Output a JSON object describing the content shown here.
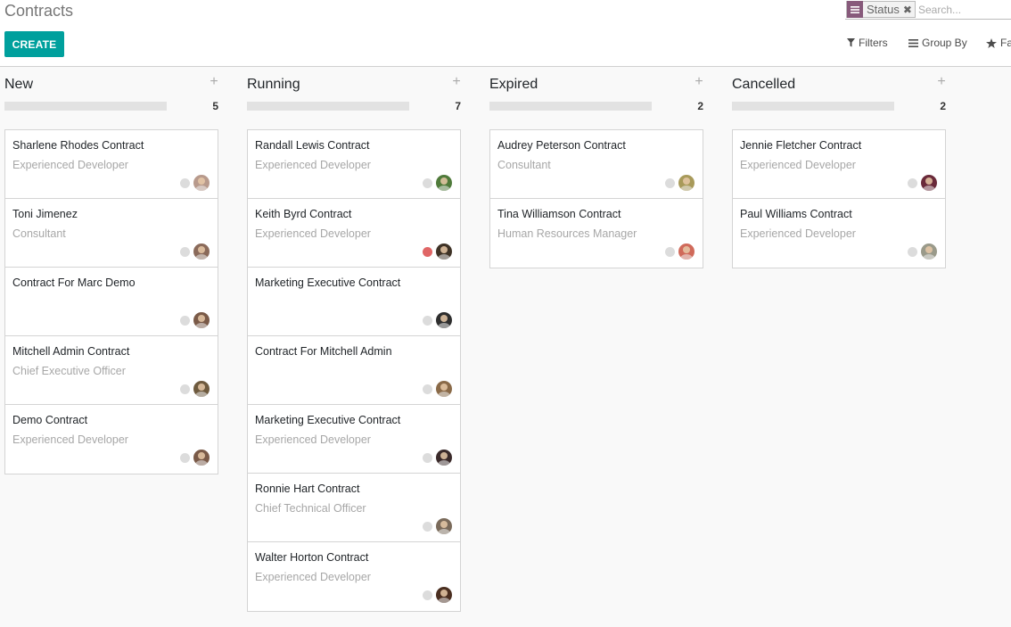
{
  "breadcrumb": "Contracts",
  "create_label": "CREATE",
  "search": {
    "facet_value": "Status",
    "placeholder": "Search...",
    "filters_label": "Filters",
    "groupby_label": "Group By",
    "favorites_label": "Fa"
  },
  "columns": [
    {
      "title": "New",
      "count": "5",
      "cards": [
        {
          "title": "Sharlene Rhodes Contract",
          "subtitle": "Experienced Developer",
          "state": "normal",
          "avatar_color": "#b89a8c"
        },
        {
          "title": "Toni Jimenez",
          "subtitle": "Consultant",
          "state": "normal",
          "avatar_color": "#8a6a5a"
        },
        {
          "title": "Contract For Marc Demo",
          "subtitle": "",
          "state": "normal",
          "avatar_color": "#7a5a48"
        },
        {
          "title": "Mitchell Admin Contract",
          "subtitle": "Chief Executive Officer",
          "state": "normal",
          "avatar_color": "#6e5a3e"
        },
        {
          "title": "Demo Contract",
          "subtitle": "Experienced Developer",
          "state": "normal",
          "avatar_color": "#7a5a48"
        }
      ]
    },
    {
      "title": "Running",
      "count": "7",
      "cards": [
        {
          "title": "Randall Lewis Contract",
          "subtitle": "Experienced Developer",
          "state": "normal",
          "avatar_color": "#4f7a3a"
        },
        {
          "title": "Keith Byrd Contract",
          "subtitle": "Experienced Developer",
          "state": "red",
          "avatar_color": "#3e3226"
        },
        {
          "title": "Marketing Executive Contract",
          "subtitle": "",
          "state": "normal",
          "avatar_color": "#2e2e2e"
        },
        {
          "title": "Contract For Mitchell Admin",
          "subtitle": "",
          "state": "normal",
          "avatar_color": "#8a6a48"
        },
        {
          "title": "Marketing Executive Contract",
          "subtitle": "Experienced Developer",
          "state": "normal",
          "avatar_color": "#3a2a2a"
        },
        {
          "title": "Ronnie Hart Contract",
          "subtitle": "Chief Technical Officer",
          "state": "normal",
          "avatar_color": "#7a6a5a"
        },
        {
          "title": "Walter Horton Contract",
          "subtitle": "Experienced Developer",
          "state": "normal",
          "avatar_color": "#4a2e20"
        }
      ]
    },
    {
      "title": "Expired",
      "count": "2",
      "cards": [
        {
          "title": "Audrey Peterson Contract",
          "subtitle": "Consultant",
          "state": "normal",
          "avatar_color": "#a89a5a"
        },
        {
          "title": "Tina Williamson Contract",
          "subtitle": "Human Resources Manager",
          "state": "normal",
          "avatar_color": "#d06a5a"
        }
      ]
    },
    {
      "title": "Cancelled",
      "count": "2",
      "cards": [
        {
          "title": "Jennie Fletcher Contract",
          "subtitle": "Experienced Developer",
          "state": "normal",
          "avatar_color": "#6a2a3a"
        },
        {
          "title": "Paul Williams Contract",
          "subtitle": "Experienced Developer",
          "state": "normal",
          "avatar_color": "#9a9a8a"
        }
      ]
    }
  ]
}
